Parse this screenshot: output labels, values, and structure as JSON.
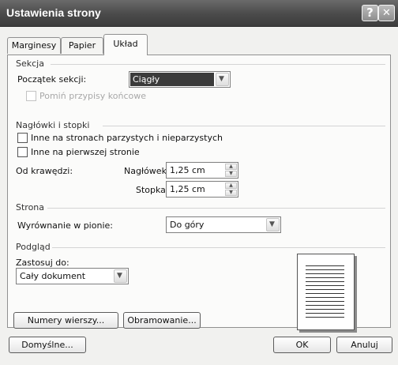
{
  "window": {
    "title": "Ustawienia strony",
    "help_label": "?",
    "close_label": "✕"
  },
  "tabs": [
    {
      "label": "Marginesy"
    },
    {
      "label": "Papier"
    },
    {
      "label": "Układ"
    }
  ],
  "sekcja": {
    "heading": "Sekcja",
    "start_label": "Początek sekcji:",
    "start_value": "Ciągły",
    "suppress_endnotes_label": "Pomiń przypisy końcowe"
  },
  "headers_footers": {
    "heading": "Nagłówki i stopki",
    "odd_even_label": "Inne na stronach parzystych i nieparzystych",
    "first_page_label": "Inne na pierwszej stronie",
    "from_edge_label": "Od krawędzi:",
    "header_label": "Nagłówek:",
    "header_value": "1,25 cm",
    "footer_label": "Stopka:",
    "footer_value": "1,25 cm"
  },
  "strona": {
    "heading": "Strona",
    "valign_label": "Wyrównanie w pionie:",
    "valign_value": "Do góry"
  },
  "preview": {
    "heading": "Podgląd",
    "apply_label": "Zastosuj do:",
    "apply_value": "Cały dokument"
  },
  "buttons": {
    "line_numbers": "Numery wierszy...",
    "borders": "Obramowanie...",
    "default": "Domyślne...",
    "ok": "OK",
    "cancel": "Anuluj"
  },
  "icons": {
    "dropdown": "chevron-down-icon",
    "spin_up": "up-arrow-icon",
    "spin_down": "down-arrow-icon"
  }
}
